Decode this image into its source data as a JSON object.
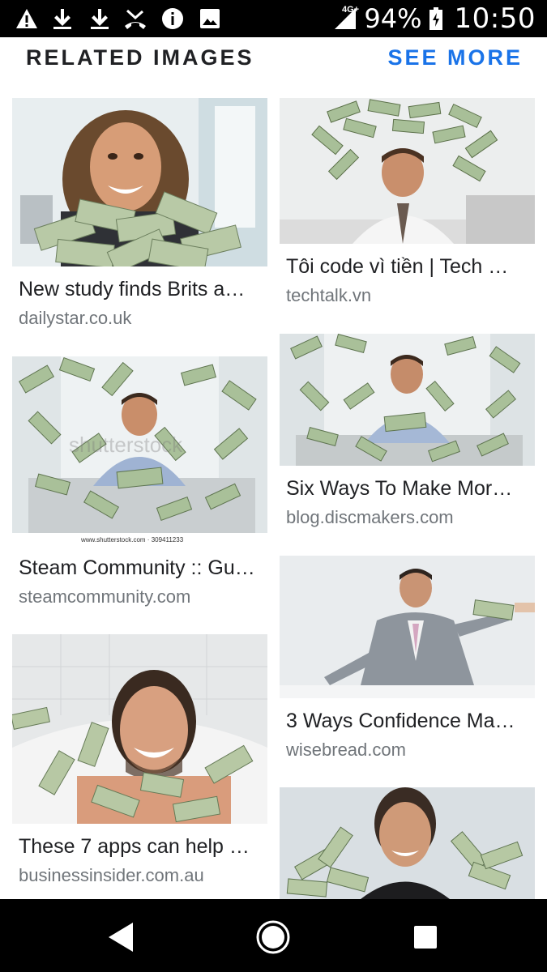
{
  "status_bar": {
    "network": "4G+",
    "battery_percent": "94%",
    "time": "10:50",
    "icons": [
      "warning-icon",
      "download-icon",
      "download-icon",
      "missed-call-icon",
      "info-icon",
      "image-icon",
      "signal-icon",
      "battery-charging-icon"
    ]
  },
  "header": {
    "title": "RELATED IMAGES",
    "see_more": "SEE MORE",
    "see_more_color": "#1a73e8"
  },
  "results": [
    {
      "title": "New study finds Brits a…",
      "source": "dailystar.co.uk"
    },
    {
      "title": "Tôi code vì tiền | Tech …",
      "source": "techtalk.vn"
    },
    {
      "title": "Steam Community :: Gu…",
      "source": "steamcommunity.com"
    },
    {
      "title": "Six Ways To Make Mor…",
      "source": "blog.discmakers.com"
    },
    {
      "title": "These 7 apps can help …",
      "source": "businessinsider.com.au"
    },
    {
      "title": "3 Ways Confidence Ma…",
      "source": "wisebread.com"
    },
    {
      "title": "",
      "source": ""
    }
  ],
  "images": {
    "watermark": "shutterstock",
    "stock_caption": "www.shutterstock.com · 309411233"
  },
  "nav": {
    "icons": [
      "back-icon",
      "home-icon",
      "recents-icon"
    ]
  }
}
